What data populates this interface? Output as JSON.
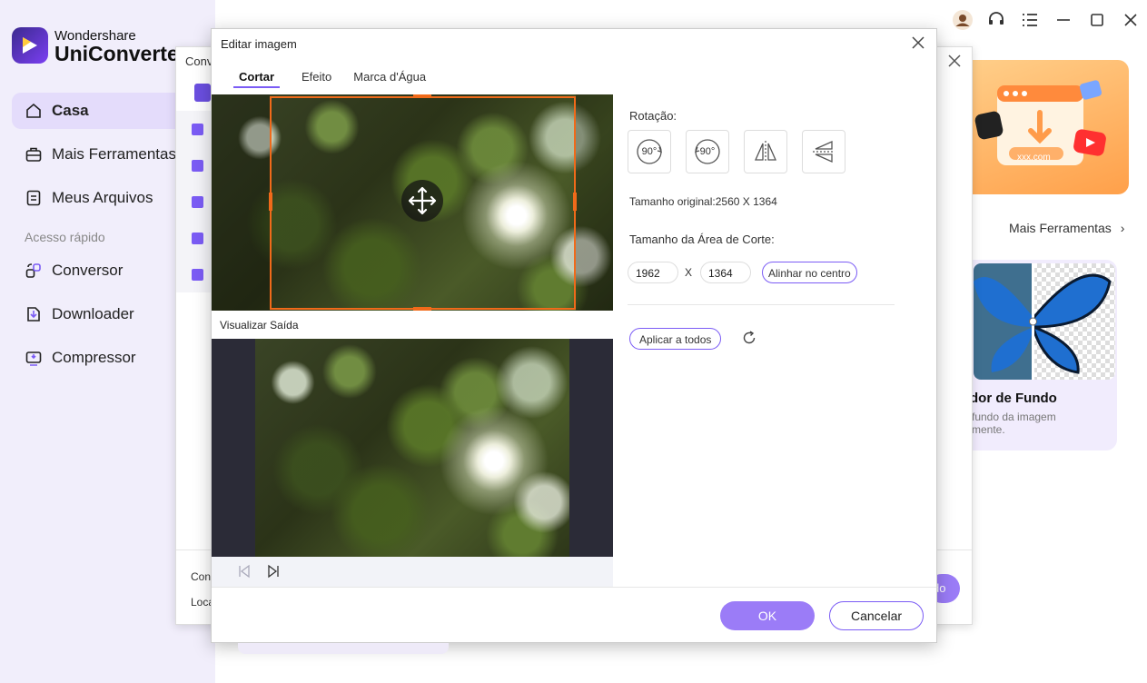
{
  "app": {
    "brand_small": "Wondershare",
    "brand_big": "UniConverter"
  },
  "sidebar": {
    "items": [
      {
        "label": "Casa"
      },
      {
        "label": "Mais Ferramentas"
      },
      {
        "label": "Meus Arquivos"
      }
    ],
    "quick_access_label": "Acesso rápido",
    "quick_items": [
      {
        "label": "Conversor"
      },
      {
        "label": "Downloader"
      },
      {
        "label": "Compressor"
      }
    ]
  },
  "main": {
    "more_tools": "Mais Ferramentas",
    "card": {
      "title": "dor de Fundo",
      "desc_line1": "fundo da imagem",
      "desc_line2": "mente."
    },
    "promo_site": "xxx.com"
  },
  "converter": {
    "title": "Conv",
    "bottom_labels": [
      "Con",
      "Loca"
    ],
    "button_label": "do"
  },
  "edit_dialog": {
    "title": "Editar imagem",
    "tabs": [
      "Cortar",
      "Efeito",
      "Marca d'Água"
    ],
    "output_label": "Visualizar Saída",
    "rotation_label": "Rotação:",
    "rot_left": "90°",
    "rot_right": "90°",
    "original_size": "Tamanho original:2560 X 1364",
    "crop_area_label": "Tamanho da Área de Corte:",
    "crop_width": "1962",
    "crop_sep": "X",
    "crop_height": "1364",
    "center_button": "Alinhar no centro",
    "apply_all": "Aplicar a todos",
    "ok": "OK",
    "cancel": "Cancelar"
  },
  "colors": {
    "accent": "#7b5cf5",
    "button": "#9b7cf7",
    "crop": "#f06a1a",
    "sidebar": "#f1eefb"
  }
}
